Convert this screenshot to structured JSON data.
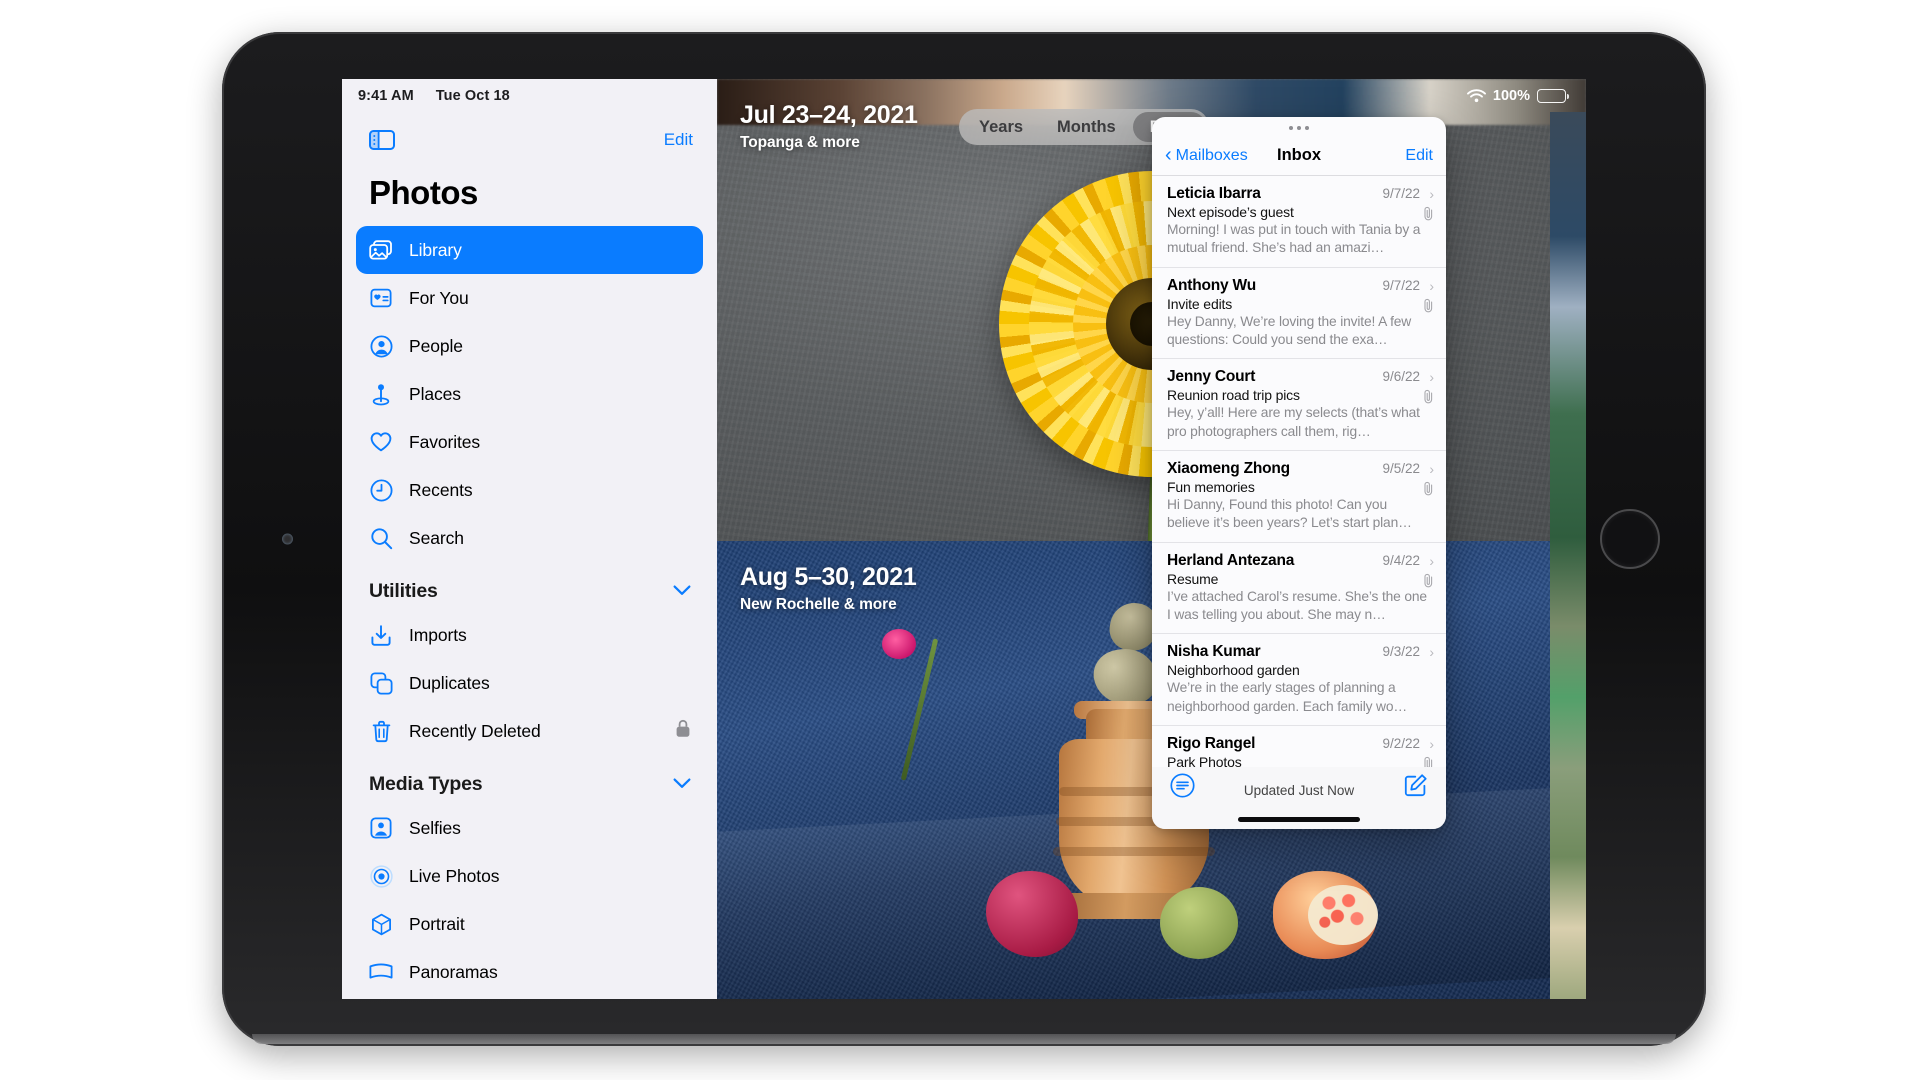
{
  "status_bar": {
    "time": "9:41 AM",
    "date": "Tue Oct 18",
    "battery_percent": "100%",
    "wifi_icon": "wifi-icon",
    "battery_icon": "battery-full-icon"
  },
  "photos_app": {
    "sidebar": {
      "toggle_icon": "sidebar-toggle-icon",
      "edit_label": "Edit",
      "title": "Photos",
      "primary_items": [
        {
          "label": "Library",
          "icon": "photo-stack-icon",
          "selected": true
        },
        {
          "label": "For You",
          "icon": "for-you-card-icon",
          "selected": false
        },
        {
          "label": "People",
          "icon": "person-circle-icon",
          "selected": false
        },
        {
          "label": "Places",
          "icon": "map-pin-icon",
          "selected": false
        },
        {
          "label": "Favorites",
          "icon": "heart-icon",
          "selected": false
        },
        {
          "label": "Recents",
          "icon": "clock-icon",
          "selected": false
        },
        {
          "label": "Search",
          "icon": "search-icon",
          "selected": false
        }
      ],
      "sections": [
        {
          "title": "Utilities",
          "collapse_icon": "chevron-down-icon",
          "items": [
            {
              "label": "Imports",
              "icon": "import-arrow-icon",
              "trailing_icon": ""
            },
            {
              "label": "Duplicates",
              "icon": "duplicate-squares-icon",
              "trailing_icon": ""
            },
            {
              "label": "Recently Deleted",
              "icon": "trash-icon",
              "trailing_icon": "lock-icon"
            }
          ]
        },
        {
          "title": "Media Types",
          "collapse_icon": "chevron-down-icon",
          "items": [
            {
              "label": "Selfies",
              "icon": "selfie-person-icon",
              "trailing_icon": ""
            },
            {
              "label": "Live Photos",
              "icon": "live-photo-icon",
              "trailing_icon": ""
            },
            {
              "label": "Portrait",
              "icon": "portrait-cube-icon",
              "trailing_icon": ""
            },
            {
              "label": "Panoramas",
              "icon": "panorama-icon",
              "trailing_icon": ""
            }
          ]
        }
      ]
    },
    "time_segment": {
      "options": [
        "Years",
        "Months",
        "Days"
      ],
      "selected": "Days"
    },
    "photo_groups": [
      {
        "date": "Jul 23–24, 2021",
        "location": "Topanga & more"
      },
      {
        "date": "Aug 5–30, 2021",
        "location": "New Rochelle & more"
      }
    ]
  },
  "mail_app": {
    "window_grabber_icon": "drag-handle-dots-icon",
    "back_label": "Mailboxes",
    "back_icon": "chevron-left-icon",
    "title": "Inbox",
    "edit_label": "Edit",
    "messages": [
      {
        "sender": "Leticia Ibarra",
        "date": "9/7/22",
        "subject": "Next episode’s guest",
        "preview": "Morning! I was put in touch with Tania by a mutual friend. She’s had an amazi…",
        "has_attachment": true
      },
      {
        "sender": "Anthony Wu",
        "date": "9/7/22",
        "subject": "Invite edits",
        "preview": "Hey Danny, We’re loving the invite! A few questions: Could you send the exa…",
        "has_attachment": true
      },
      {
        "sender": "Jenny Court",
        "date": "9/6/22",
        "subject": "Reunion road trip pics",
        "preview": "Hey, y’all! Here are my selects (that’s what pro photographers call them, rig…",
        "has_attachment": true
      },
      {
        "sender": "Xiaomeng Zhong",
        "date": "9/5/22",
        "subject": "Fun memories",
        "preview": "Hi Danny, Found this photo! Can you believe it’s been years? Let’s start plan…",
        "has_attachment": true
      },
      {
        "sender": "Herland Antezana",
        "date": "9/4/22",
        "subject": "Resume",
        "preview": "I’ve attached Carol’s resume. She’s the one I was telling you about. She may n…",
        "has_attachment": true
      },
      {
        "sender": "Nisha Kumar",
        "date": "9/3/22",
        "subject": "Neighborhood garden",
        "preview": "We’re in the early stages of planning a neighborhood garden. Each family wo…",
        "has_attachment": false
      },
      {
        "sender": "Rigo Rangel",
        "date": "9/2/22",
        "subject": "Park Photos",
        "preview": "",
        "has_attachment": true
      }
    ],
    "toolbar": {
      "filter_icon": "filter-lines-icon",
      "status_text": "Updated Just Now",
      "compose_icon": "compose-pencil-icon"
    }
  },
  "colors": {
    "accent_blue": "#0a7cff",
    "sidebar_bg": "#f2f1f6",
    "mail_bg": "#fbfbfd",
    "secondary_text": "#8a8a8e"
  }
}
